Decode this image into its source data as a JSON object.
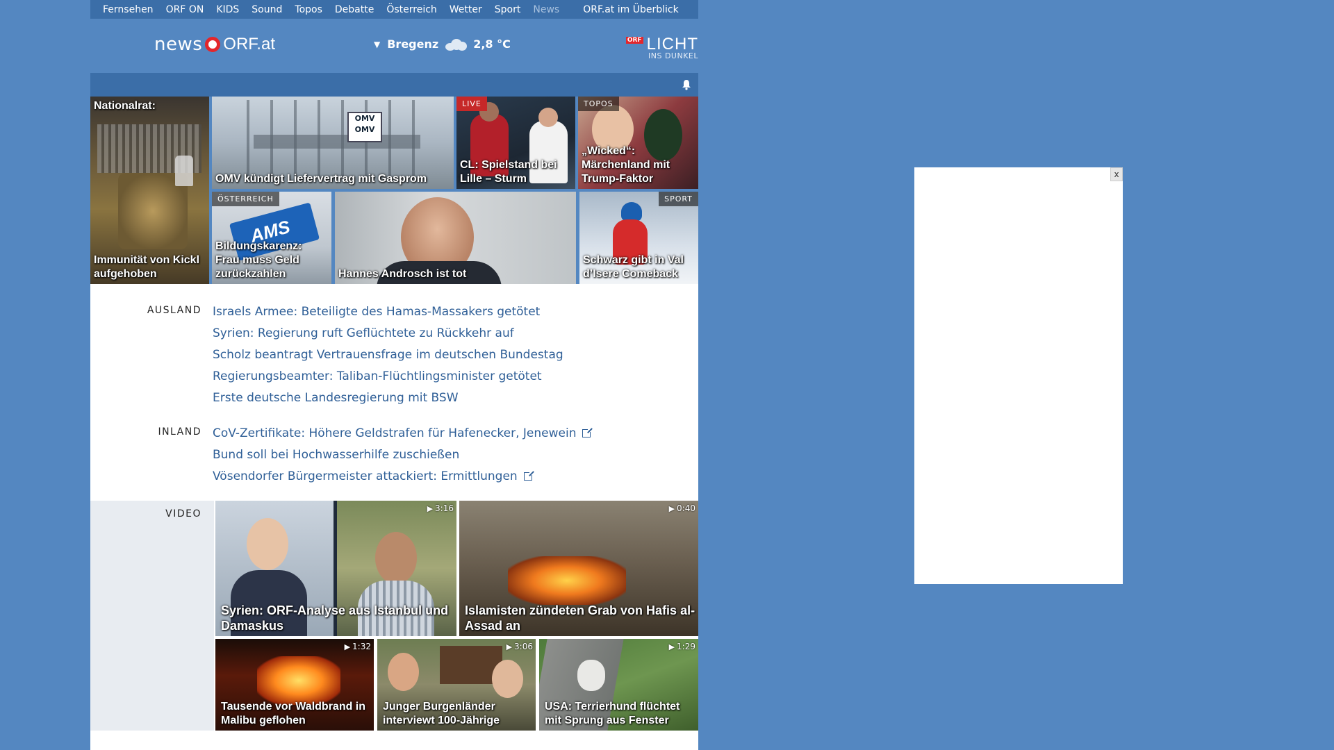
{
  "nav": {
    "items": [
      "Fernsehen",
      "ORF ON",
      "KIDS",
      "Sound",
      "Topos",
      "Debatte",
      "Österreich",
      "Wetter",
      "Sport",
      "News"
    ],
    "active": "News",
    "overview": "ORF.at im Überblick"
  },
  "header": {
    "logo_news": "news",
    "logo_orf": "ORF.at",
    "weather_city": "Bregenz",
    "weather_temp": "2,8 °C",
    "licht_badge": "ORF",
    "licht_title": "LICHT",
    "licht_sub": "INS DUNKEL"
  },
  "tiles": [
    {
      "title": "Nationalrat:",
      "bottom": "Immunität von Kickl aufgehoben",
      "tag": ""
    },
    {
      "title": "OMV kündigt Liefervertrag mit Gasprom",
      "tag": ""
    },
    {
      "title": "CL: Spielstand bei Lille – Sturm",
      "tag": "LIVE"
    },
    {
      "title": "„Wicked“: Märchenland mit Trump-Faktor",
      "tag": "TOPOS"
    },
    {
      "title": "Bildungskarenz: Frau muss Geld zurückzahlen",
      "tag": "ÖSTERREICH"
    },
    {
      "title": "Hannes Androsch ist tot",
      "tag": ""
    },
    {
      "title": "Schwarz gibt in Val d’Isere Comeback",
      "tag": "SPORT"
    }
  ],
  "ausland": {
    "label": "AUSLAND",
    "links": [
      "Israels Armee: Beteiligte des Hamas-Massakers getötet",
      "Syrien: Regierung ruft Geflüchtete zu Rückkehr auf",
      "Scholz beantragt Vertrauensfrage im deutschen Bundestag",
      "Regierungsbeamter: Taliban-Flüchtlingsminister getötet",
      "Erste deutsche Landesregierung mit BSW"
    ]
  },
  "inland": {
    "label": "INLAND",
    "links": [
      "CoV-Zertifikate: Höhere Geldstrafen für Hafenecker, Jenewein",
      "Bund soll bei Hochwasserhilfe zuschießen",
      "Vösendorfer Bürgermeister attackiert: Ermittlungen"
    ]
  },
  "video": {
    "label": "VIDEO",
    "items": [
      {
        "title": "Syrien: ORF-Analyse aus Istanbul und Damaskus",
        "duration": "3:16"
      },
      {
        "title": "Islamisten zündeten Grab von Hafis al-Assad an",
        "duration": "0:40"
      },
      {
        "title": "Tausende vor Waldbrand in Malibu geflohen",
        "duration": "1:32"
      },
      {
        "title": "Junger Burgenländer interviewt 100-Jährige",
        "duration": "3:06"
      },
      {
        "title": "USA: Terrierhund flüchtet mit Sprung aus Fenster",
        "duration": "1:29"
      }
    ]
  },
  "ad": {
    "close": "x"
  },
  "colors": {
    "background": "#5487c1",
    "nav": "#3b6ea8",
    "link": "#2f5f97",
    "orf_red": "#e4262b"
  }
}
